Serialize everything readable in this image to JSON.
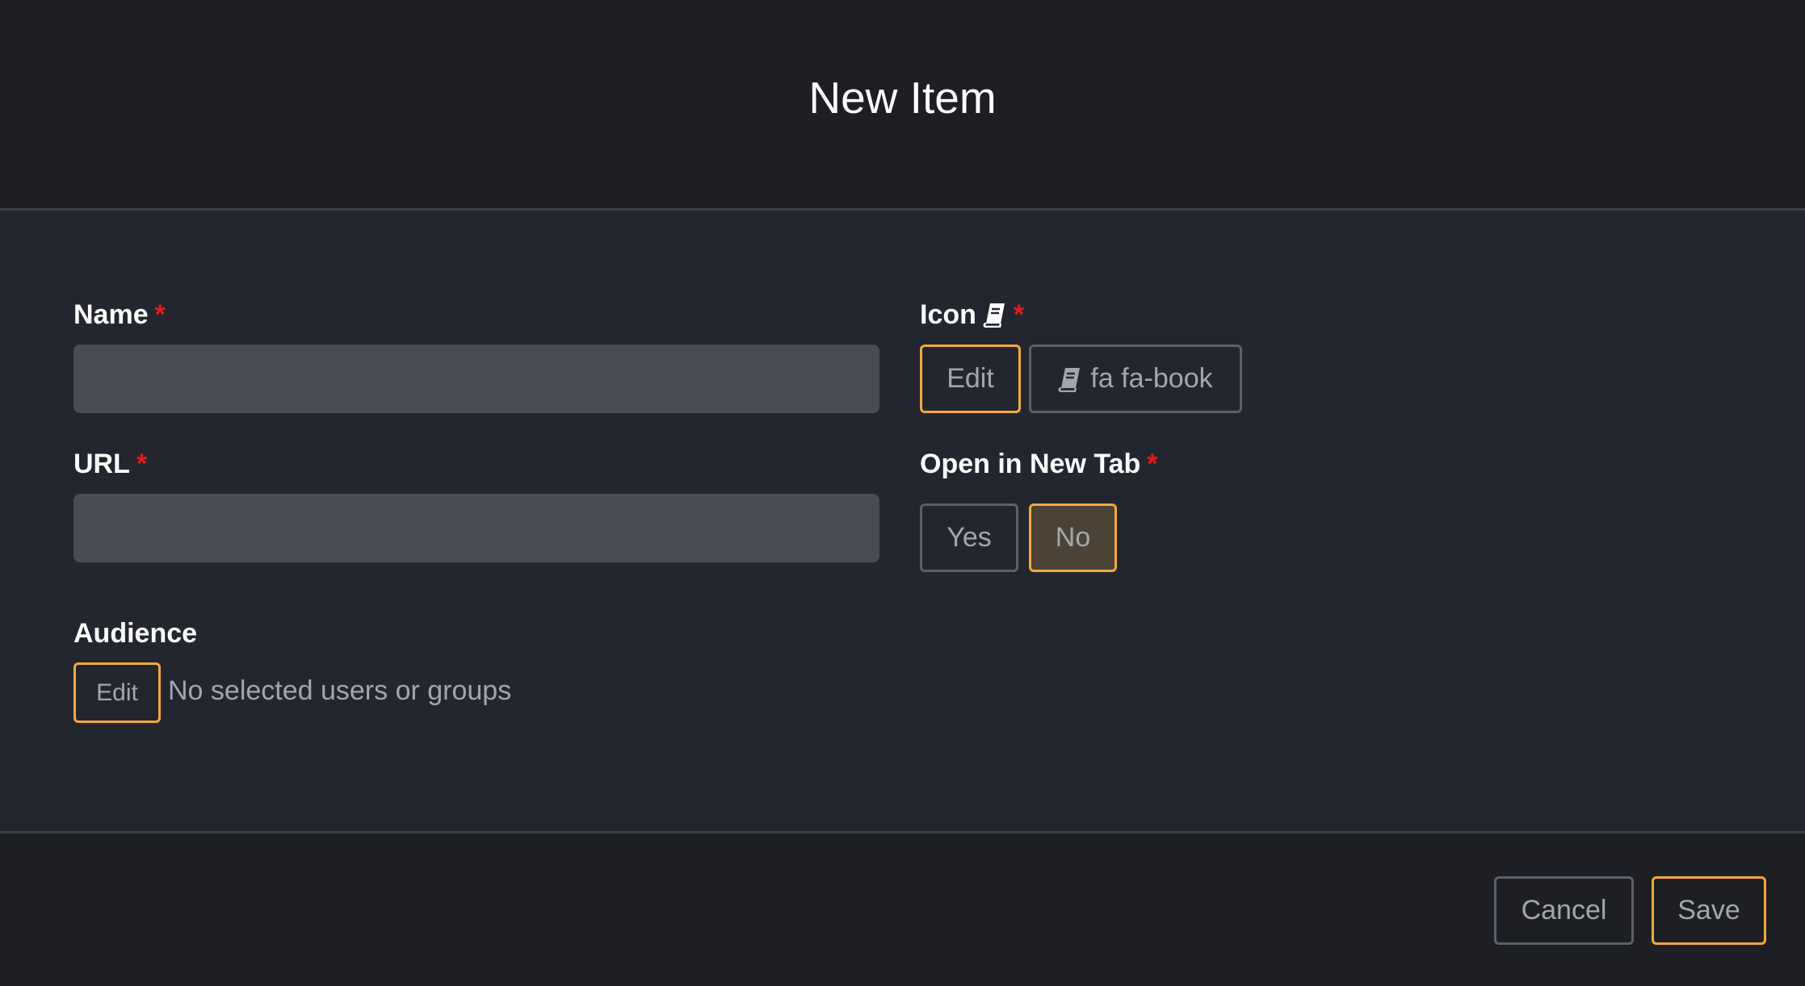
{
  "modal": {
    "title": "New Item"
  },
  "form": {
    "name": {
      "label": "Name",
      "required_mark": "*",
      "value": "",
      "placeholder": ""
    },
    "url": {
      "label": "URL",
      "required_mark": "*",
      "value": "",
      "placeholder": ""
    },
    "icon": {
      "label": "Icon",
      "required_mark": "*",
      "label_icon": "book-icon",
      "edit_label": "Edit",
      "current_value": "fa fa-book",
      "current_icon": "book-icon"
    },
    "open_in_new_tab": {
      "label": "Open in New Tab",
      "required_mark": "*",
      "options": [
        "Yes",
        "No"
      ],
      "selected": "No"
    },
    "audience": {
      "label": "Audience",
      "edit_label": "Edit",
      "summary": "No selected users or groups"
    }
  },
  "footer": {
    "cancel_label": "Cancel",
    "save_label": "Save"
  },
  "colors": {
    "accent": "#f5a939",
    "required": "#e51a1a",
    "header_bg": "#1e1f24",
    "body_bg": "#23262e",
    "input_bg": "#4a4c55",
    "selected_bg": "#4c4336"
  }
}
